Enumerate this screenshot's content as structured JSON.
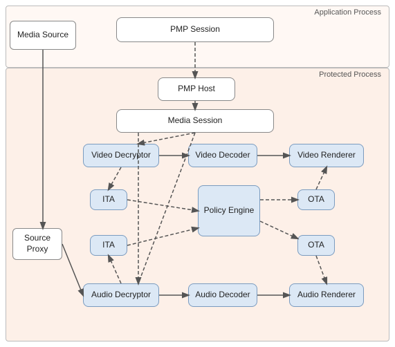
{
  "regions": {
    "app_process": "Application Process",
    "protected_process": "Protected Process"
  },
  "boxes": {
    "media_source": "Media Source",
    "pmp_session": "PMP Session",
    "pmp_host": "PMP Host",
    "media_session": "Media Session",
    "source_proxy": "Source Proxy",
    "video_decryptor": "Video Decryptor",
    "video_decoder": "Video Decoder",
    "video_renderer": "Video Renderer",
    "ita_top": "ITA",
    "ota_top": "OTA",
    "policy_engine": "Policy Engine",
    "ita_bottom": "ITA",
    "ota_bottom": "OTA",
    "audio_decryptor": "Audio Decryptor",
    "audio_decoder": "Audio Decoder",
    "audio_renderer": "Audio Renderer"
  }
}
